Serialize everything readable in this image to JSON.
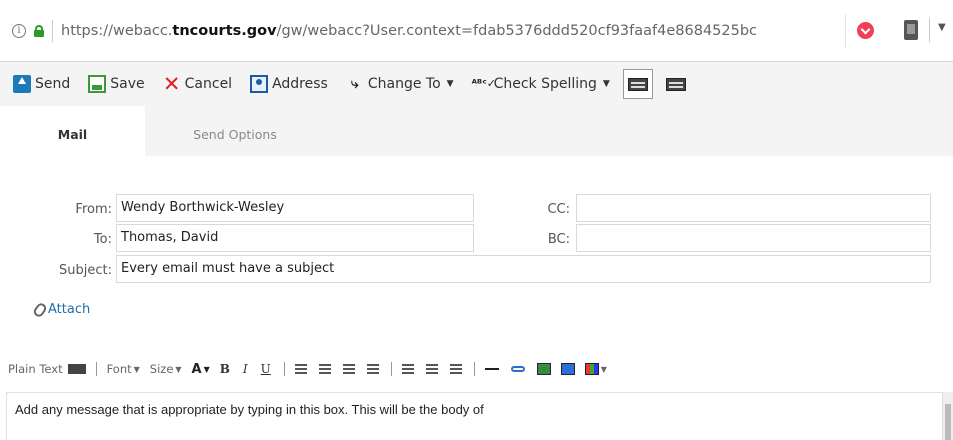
{
  "browser": {
    "url_prefix": "https://webacc.",
    "url_domain": "tncourts.gov",
    "url_suffix": "/gw/webacc?User.context=fdab5376ddd520cf93faaf4e8684525bc",
    "icons": [
      "info-icon",
      "lock-icon",
      "pocket-icon",
      "extension-icon",
      "menu-chevron-icon"
    ]
  },
  "toolbar": {
    "send": "Send",
    "save": "Save",
    "cancel": "Cancel",
    "address": "Address",
    "change_to": "Change To",
    "check_spelling": "Check Spelling"
  },
  "tabs": {
    "mail": "Mail",
    "send_options": "Send Options"
  },
  "form": {
    "from_label": "From:",
    "from_value": "Wendy Borthwick-Wesley",
    "to_label": "To:",
    "to_value": "Thomas, David",
    "subject_label": "Subject:",
    "subject_value": "Every email must have a subject",
    "cc_label": "CC:",
    "cc_value": "",
    "bc_label": "BC:",
    "bc_value": "",
    "attach_label": "Attach"
  },
  "editor_toolbar": {
    "plain_text": "Plain Text",
    "font": "Font",
    "size": "Size",
    "bold": "B",
    "italic": "I",
    "underline": "U"
  },
  "body": {
    "text": "Add any message that is appropriate by typing in this box.  This will be the body of"
  },
  "colors": {
    "link": "#1b6fa8",
    "send_blue": "#1b7ab8",
    "save_green": "#3a9a3a",
    "cancel_red": "#dd2222"
  }
}
